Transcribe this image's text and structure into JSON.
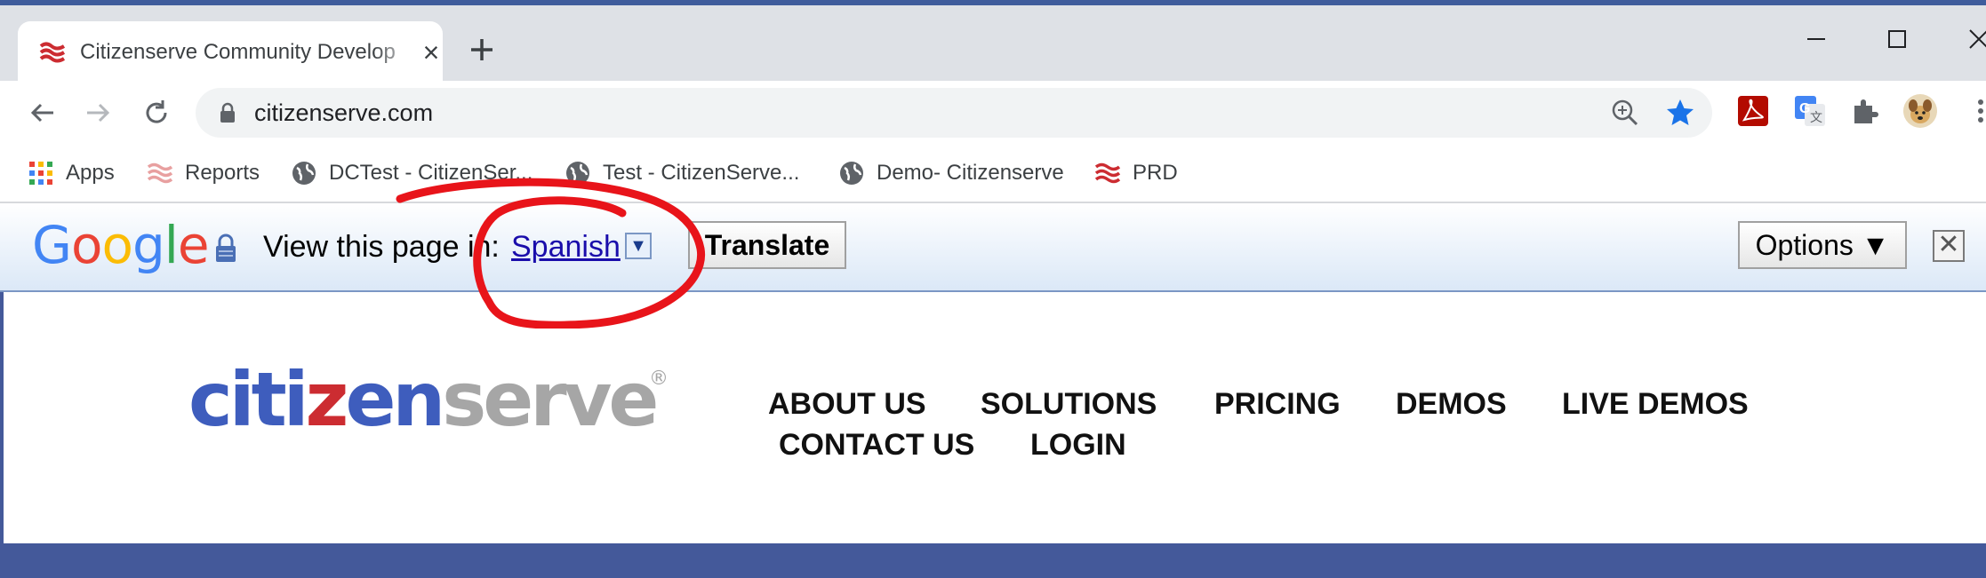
{
  "tab": {
    "title": "Citizenserve Community Develop",
    "close": "×",
    "new_tab": "+"
  },
  "window_controls": {
    "minimize": "minimize-icon",
    "maximize": "maximize-icon",
    "close": "close-icon"
  },
  "toolbar": {
    "url": "citizenserve.com"
  },
  "bookmarks": [
    {
      "label": "Apps",
      "icon": "apps-grid-icon"
    },
    {
      "label": "Reports",
      "icon": "citizenserve-icon"
    },
    {
      "label": "DCTest - CitizenSer...",
      "icon": "globe-icon"
    },
    {
      "label": "Test - CitizenServe...",
      "icon": "globe-icon"
    },
    {
      "label": "Demo- Citizenserve",
      "icon": "globe-icon"
    },
    {
      "label": "PRD",
      "icon": "citizenserve-icon"
    }
  ],
  "translate_bar": {
    "logo": "Google",
    "prompt": "View this page in:",
    "language": "Spanish",
    "dropdown_glyph": "▼",
    "translate_label": "Translate",
    "options_label": "Options ▼",
    "close_glyph": "✕"
  },
  "site": {
    "logo_parts": {
      "citi": "citi",
      "z": "z",
      "en": "en",
      "serve": "serve",
      "reg": "®"
    },
    "menu": [
      "ABOUT US",
      "SOLUTIONS",
      "PRICING",
      "DEMOS",
      "LIVE DEMOS",
      "CONTACT US",
      "LOGIN"
    ]
  },
  "colors": {
    "brand_blue": "#3e5dbd",
    "brand_red": "#cc2c31",
    "brand_gray": "#a6a6a6",
    "banner": "#44599a",
    "annotation_red": "#e8141a"
  }
}
